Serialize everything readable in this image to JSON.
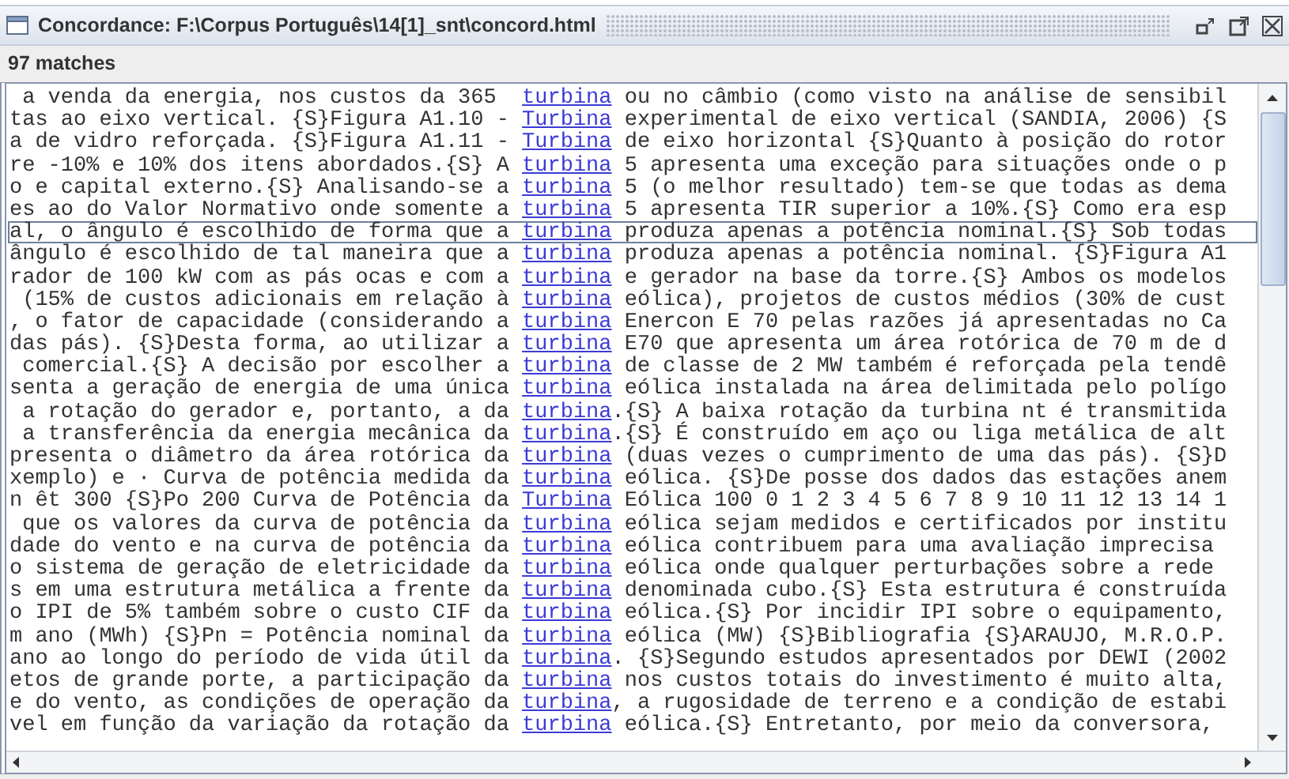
{
  "window": {
    "title": "Concordance: F:\\Corpus Português\\14[1]_snt\\concord.html"
  },
  "match_count": "97 matches",
  "rows": [
    {
      "left": "a venda da energia, nos custos da 365  ",
      "keyword": "turbina",
      "right": " ou no câmbio (como visto na análise de sensibil",
      "selected": false
    },
    {
      "left": "tas ao eixo vertical. {S}Figura A1.10 - ",
      "keyword": "Turbina",
      "right": " experimental de eixo vertical (SANDIA, 2006) {S",
      "selected": false
    },
    {
      "left": "a de vidro reforçada. {S}Figura A1.11 - ",
      "keyword": "Turbina",
      "right": " de eixo horizontal {S}Quanto à posição do rotor",
      "selected": false
    },
    {
      "left": "re -10% e 10% dos itens abordados.{S} A ",
      "keyword": "turbina",
      "right": " 5 apresenta uma exceção para situações onde o p",
      "selected": false
    },
    {
      "left": "o e capital externo.{S} Analisando-se a ",
      "keyword": "turbina",
      "right": " 5 (o melhor resultado) tem-se que todas as dema",
      "selected": false
    },
    {
      "left": "es ao do Valor Normativo onde somente a ",
      "keyword": "turbina",
      "right": " 5 apresenta TIR superior a 10%.{S} Como era esp",
      "selected": false
    },
    {
      "left": "al, o ângulo é escolhido de forma que a ",
      "keyword": "turbina",
      "right": " produza apenas a potência nominal.{S} Sob todas",
      "selected": true
    },
    {
      "left": "ângulo é escolhido de tal maneira que a ",
      "keyword": "turbina",
      "right": " produza apenas a potência nominal. {S}Figura A1",
      "selected": false
    },
    {
      "left": "rador de 100 kW com as pás ocas e com a ",
      "keyword": "turbina",
      "right": " e gerador na base da torre.{S} Ambos os modelos",
      "selected": false
    },
    {
      "left": " (15% de custos adicionais em relação à ",
      "keyword": "turbina",
      "right": " eólica), projetos de custos médios (30% de cust",
      "selected": false
    },
    {
      "left": ", o fator de capacidade (considerando a ",
      "keyword": "turbina",
      "right": " Enercon E 70 pelas razões já apresentadas no Ca",
      "selected": false
    },
    {
      "left": "das pás). {S}Desta forma, ao utilizar a ",
      "keyword": "turbina",
      "right": " E70 que apresenta um área rotórica de 70 m de d",
      "selected": false
    },
    {
      "left": " comercial.{S} A decisão por escolher a ",
      "keyword": "turbina",
      "right": " de classe de 2 MW também é reforçada pela tendê",
      "selected": false
    },
    {
      "left": "senta a geração de energia de uma única ",
      "keyword": "turbina",
      "right": " eólica instalada na área delimitada pelo polígo",
      "selected": false
    },
    {
      "left": " a rotação do gerador e, portanto, a da ",
      "keyword": "turbina",
      "right": ".{S} A baixa rotação da turbina nt é transmitida",
      "selected": false
    },
    {
      "left": " a transferência da energia mecânica da ",
      "keyword": "turbina",
      "right": ".{S} É construído em aço ou liga metálica de alt",
      "selected": false
    },
    {
      "left": "presenta o diâmetro da área rotórica da ",
      "keyword": "turbina",
      "right": " (duas vezes o cumprimento de uma das pás). {S}D",
      "selected": false
    },
    {
      "left": "xemplo) e · Curva de potência medida da ",
      "keyword": "turbina",
      "right": " eólica. {S}De posse dos dados das estações anem",
      "selected": false
    },
    {
      "left": "n êt 300 {S}Po 200 Curva de Potência da ",
      "keyword": "Turbina",
      "right": " Eólica 100 0 1 2 3 4 5 6 7 8 9 10 11 12 13 14 1",
      "selected": false
    },
    {
      "left": " que os valores da curva de potência da ",
      "keyword": "turbina",
      "right": " eólica sejam medidos e certificados por institu",
      "selected": false
    },
    {
      "left": "dade do vento e na curva de potência da ",
      "keyword": "turbina",
      "right": " eólica contribuem para uma avaliação imprecisa",
      "selected": false
    },
    {
      "left": "o sistema de geração de eletricidade da ",
      "keyword": "turbina",
      "right": " eólica onde qualquer perturbações sobre a rede",
      "selected": false
    },
    {
      "left": "s em uma estrutura metálica a frente da ",
      "keyword": "turbina",
      "right": " denominada cubo.{S} Esta estrutura é construída",
      "selected": false
    },
    {
      "left": "o IPI de 5% também sobre o custo CIF da ",
      "keyword": "turbina",
      "right": " eólica.{S} Por incidir IPI sobre o equipamento,",
      "selected": false
    },
    {
      "left": "m ano (MWh) {S}Pn = Potência nominal da ",
      "keyword": "turbina",
      "right": " eólica (MW) {S}Bibliografia {S}ARAUJO, M.R.O.P.",
      "selected": false
    },
    {
      "left": "ano ao longo do período de vida útil da ",
      "keyword": "turbina",
      "right": ". {S}Segundo estudos apresentados por DEWI (2002",
      "selected": false
    },
    {
      "left": "etos de grande porte, a participação da ",
      "keyword": "turbina",
      "right": " nos custos totais do investimento é muito alta,",
      "selected": false
    },
    {
      "left": "e do vento, as condições de operação da ",
      "keyword": "turbina",
      "right": ", a rugosidade de terreno e a condição de estabi",
      "selected": false
    },
    {
      "left": "vel em função da variação da rotação da ",
      "keyword": "turbina",
      "right": " eólica.{S} Entretanto, por meio da conversora,",
      "selected": false
    }
  ]
}
